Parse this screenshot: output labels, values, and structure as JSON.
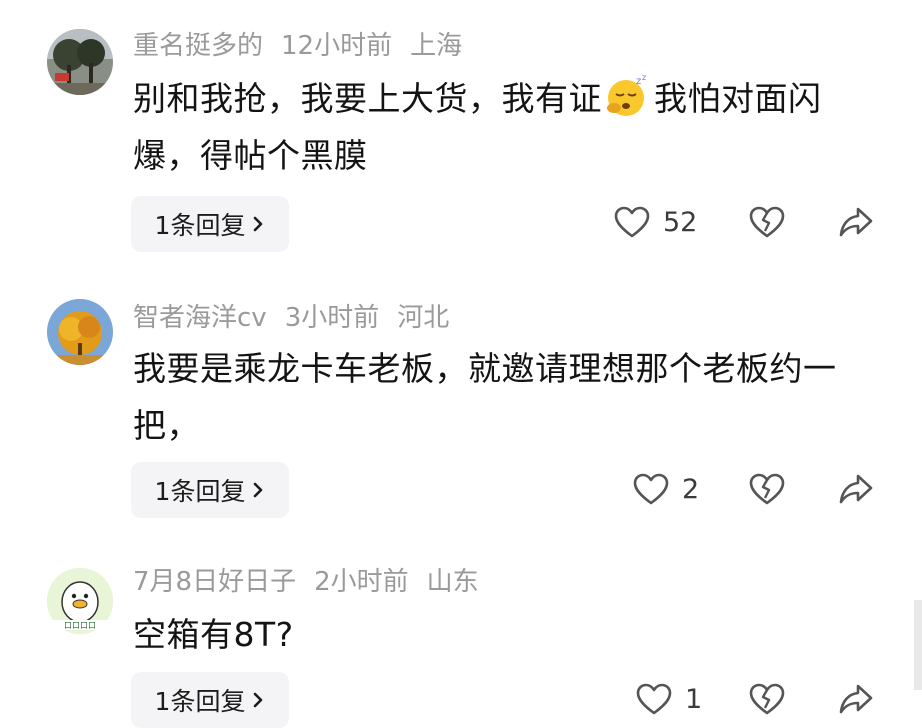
{
  "comments": [
    {
      "username": "重名挺多的",
      "time": "12小时前",
      "location": "上海",
      "text_before_emoji": "别和我抢，我要上大货，我有证",
      "text_after_emoji": "我怕对面闪爆，得帖个黑膜",
      "emoji": "sleepy-face-emoji",
      "reply_label": "1条回复",
      "likes": "52"
    },
    {
      "username": "智者海洋cv",
      "time": "3小时前",
      "location": "河北",
      "text": "我要是乘龙卡车老板，就邀请理想那个老板约一把，",
      "reply_label": "1条回复",
      "likes": "2"
    },
    {
      "username": "7月8日好日子",
      "time": "2小时前",
      "location": "山东",
      "text": "空箱有8T?",
      "reply_label": "1条回复",
      "likes": "1"
    }
  ],
  "colors": {
    "meta": "#9a9a9a",
    "text": "#141414",
    "reply_bg": "#f4f4f6",
    "icon": "#555555"
  }
}
